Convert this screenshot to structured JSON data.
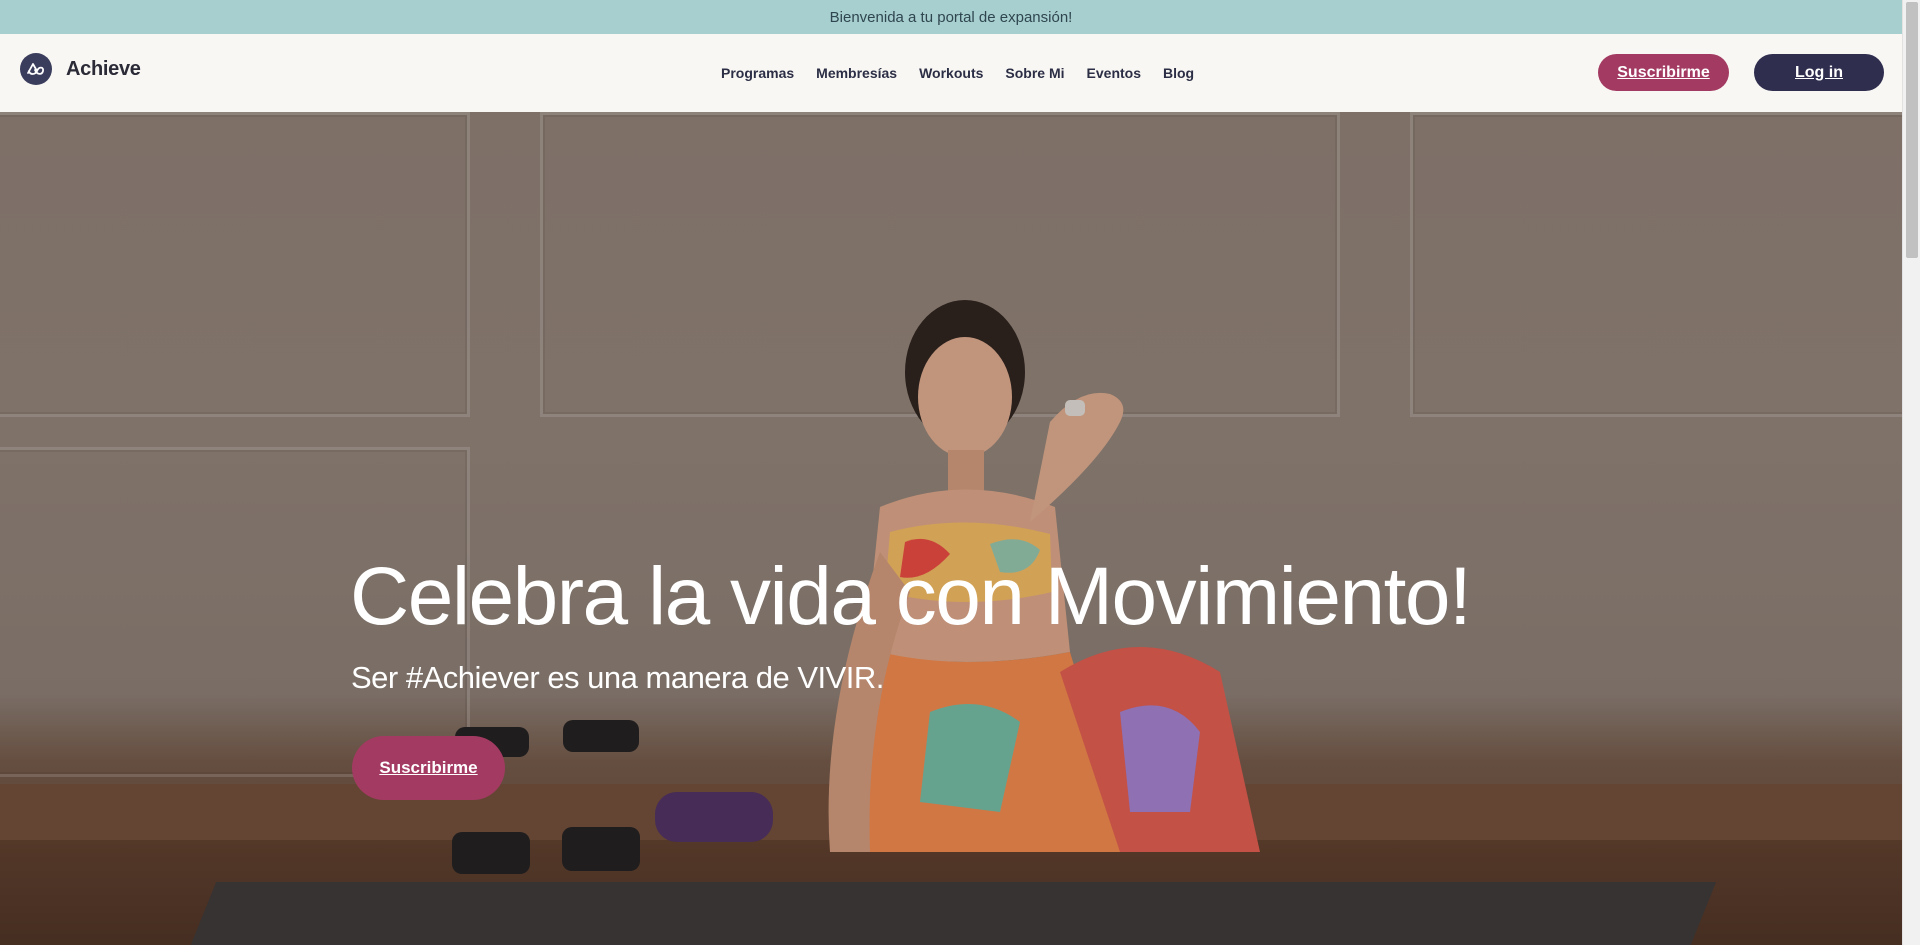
{
  "announcement": {
    "text": "Bienvenida a tu portal de expansión!"
  },
  "brand": {
    "name": "Achieve",
    "logo_icon": "infinity-mountain-icon",
    "logo_color": "#3a3d5c"
  },
  "nav": {
    "items": [
      {
        "label": "Programas"
      },
      {
        "label": "Membresías"
      },
      {
        "label": "Workouts"
      },
      {
        "label": "Sobre Mi"
      },
      {
        "label": "Eventos"
      },
      {
        "label": "Blog"
      }
    ]
  },
  "header_actions": {
    "subscribe_label": "Suscribirme",
    "login_label": "Log in"
  },
  "hero": {
    "title": "Celebra la vida con Movimiento!",
    "subtitle": "Ser #Achiever es una manera de VIVIR.",
    "cta_label": "Suscribirme"
  },
  "colors": {
    "accent": "#a33a62",
    "dark": "#2f2e4f",
    "announcement_bg": "#a8cfcf",
    "header_bg": "#f9f7f3"
  }
}
